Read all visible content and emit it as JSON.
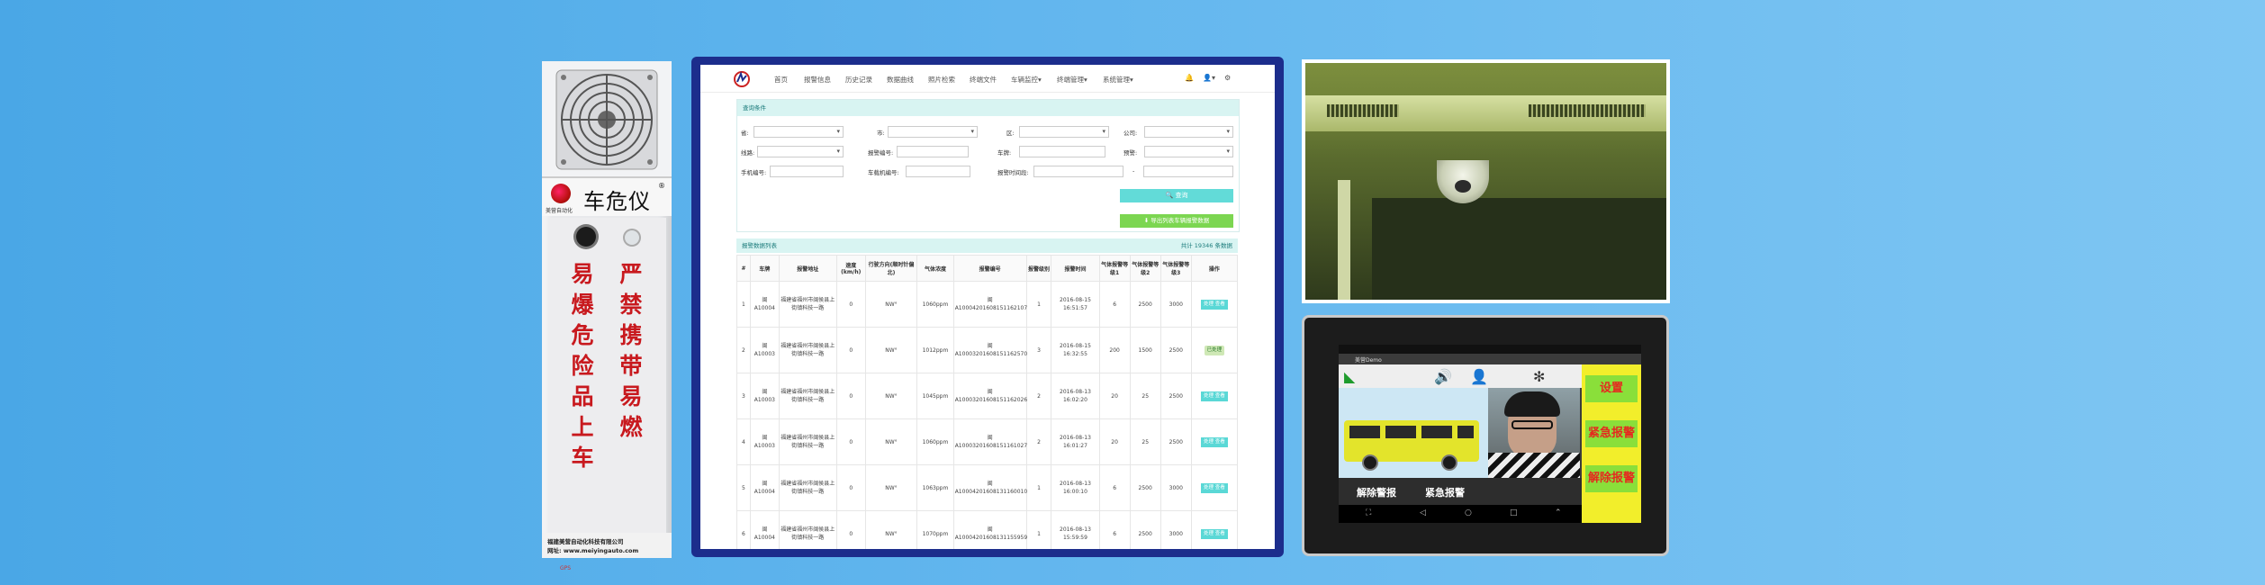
{
  "device": {
    "brand": "车危仪",
    "reg_mark": "®",
    "logo_sub": "美营自动化",
    "col_left": "易爆危险品上车",
    "col_right": "严禁携带易燃",
    "small_red": "GPS",
    "company": "福建美营自动化科技有限公司",
    "website": "网址: www.meiyingauto.com"
  },
  "webapp": {
    "nav": [
      "首页",
      "报警信息",
      "历史记录",
      "数据曲线",
      "照片检索",
      "终端文件",
      "车辆监控▾",
      "终端管理▾",
      "系统管理▾"
    ],
    "nav_icons": [
      "bell-icon",
      "user-icon",
      "gear-icon"
    ],
    "nav_icon_glyphs": [
      "🔔",
      "👤▾",
      "⚙"
    ],
    "query": {
      "title": "查询条件",
      "row1": [
        "省:",
        "市:",
        "区:",
        "公司:"
      ],
      "row2": [
        "线路:",
        "报警编号:",
        "车牌:",
        "预警:"
      ],
      "row3": [
        "手机编号:",
        "车载机编号:",
        "报警时间段:"
      ],
      "range_sep": "-",
      "query_btn": "🔍 查询",
      "export_btn": "⬇ 导出列表车辆报警数据"
    },
    "list": {
      "title": "报警数据列表",
      "total": "共计 19346 条数据",
      "headers": [
        "#",
        "车牌",
        "报警地址",
        "速度(km/h)",
        "行驶方向(顺时针偏北)",
        "气体浓度",
        "报警编号",
        "报警级别",
        "报警时间",
        "气体报警等级1",
        "气体报警等级2",
        "气体报警等级3",
        "操作"
      ],
      "rows": [
        {
          "n": "1",
          "plate": "闽A10004",
          "addr": "福建省福州市闽侯县上街镇科技一路",
          "speed": "0",
          "dir": "NW°",
          "gas": "1060ppm",
          "code": "闽A10004201608151162107",
          "level": "1",
          "time": "2016-08-15 16:51:57",
          "g1": "6",
          "g2": "2500",
          "g3": "3000",
          "op": "处理 查看",
          "cls": ""
        },
        {
          "n": "2",
          "plate": "闽A10003",
          "addr": "福建省福州市闽侯县上街镇科技一路",
          "speed": "0",
          "dir": "NW°",
          "gas": "1012ppm",
          "code": "闽A10003201608151162570",
          "level": "3",
          "time": "2016-08-15 16:32:55",
          "g1": "200",
          "g2": "1500",
          "g3": "2500",
          "op": "已处理",
          "cls": "red"
        },
        {
          "n": "3",
          "plate": "闽A10003",
          "addr": "福建省福州市闽侯县上街镇科技一路",
          "speed": "0",
          "dir": "NW°",
          "gas": "1045ppm",
          "code": "闽A10003201608151162026",
          "level": "2",
          "time": "2016-08-13 16:02:20",
          "g1": "20",
          "g2": "25",
          "g3": "2500",
          "op": "处理 查看",
          "cls": "orange"
        },
        {
          "n": "4",
          "plate": "闽A10003",
          "addr": "福建省福州市闽侯县上街镇科技一路",
          "speed": "0",
          "dir": "NW°",
          "gas": "1060ppm",
          "code": "闽A10003201608151161027",
          "level": "2",
          "time": "2016-08-13 16:01:27",
          "g1": "20",
          "g2": "25",
          "g3": "2500",
          "op": "处理 查看",
          "cls": "orange"
        },
        {
          "n": "5",
          "plate": "闽A10004",
          "addr": "福建省福州市闽侯县上街镇科技一路",
          "speed": "0",
          "dir": "NW°",
          "gas": "1063ppm",
          "code": "闽A10004201608131160010",
          "level": "1",
          "time": "2016-08-13 16:00:10",
          "g1": "6",
          "g2": "2500",
          "g3": "3000",
          "op": "处理 查看",
          "cls": ""
        },
        {
          "n": "6",
          "plate": "闽A10004",
          "addr": "福建省福州市闽侯县上街镇科技一路",
          "speed": "0",
          "dir": "NW°",
          "gas": "1070ppm",
          "code": "闽A10004201608131155959",
          "level": "1",
          "time": "2016-08-13 15:59:59",
          "g1": "6",
          "g2": "2500",
          "g3": "3000",
          "op": "处理 查看",
          "cls": ""
        }
      ]
    }
  },
  "tablet": {
    "title": "美营Demo",
    "side_menu": [
      "设置",
      "紧急报警",
      "解除报警"
    ],
    "bottom": [
      "解除警报",
      "紧急报警"
    ],
    "nav": [
      "⛶",
      "◁",
      "○",
      "□",
      "⌃"
    ]
  },
  "colors": {
    "background": "#62b6ee",
    "monitor_frame": "#1c2d8c",
    "accent_teal": "#5ad8d6",
    "export_green": "#7cd651",
    "alarm_red": "#c2333a",
    "tablet_yellow": "#f2ee2b"
  }
}
